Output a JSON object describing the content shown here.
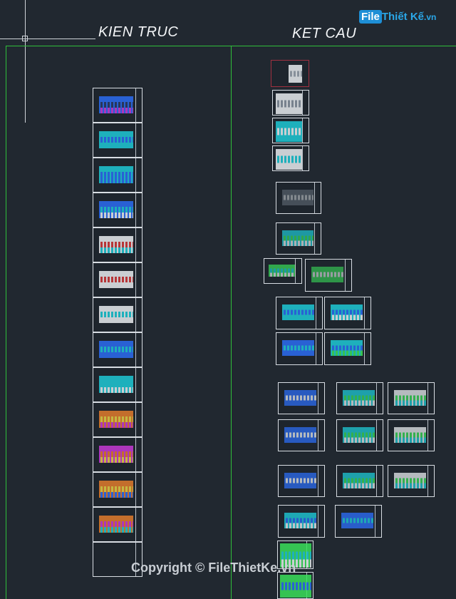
{
  "header": {
    "left_title": "KIEN TRUC",
    "right_title": "KET CAU"
  },
  "watermark": {
    "logo_text_a": "File",
    "logo_text_b": "Thiết Kế",
    "logo_text_c": ".vn",
    "copyright": "Copyright © FileThietKe.vn"
  },
  "colors": {
    "background": "#212830",
    "boundary": "#2fbf3b",
    "cyan": "#1ec9d6",
    "blue": "#2c6cf2",
    "yellow": "#e4d245",
    "magenta": "#c63ad6",
    "orange": "#e07b2c",
    "green": "#3adf5a",
    "red": "#d23a3a",
    "white": "#e8ecef"
  }
}
